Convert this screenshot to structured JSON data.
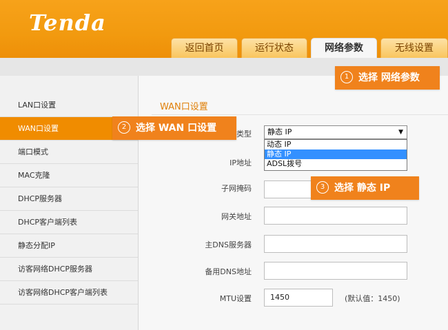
{
  "brand": {
    "logo": "Tenda"
  },
  "tabs": [
    {
      "label": "返回首页",
      "active": false
    },
    {
      "label": "运行状态",
      "active": false
    },
    {
      "label": "网络参数",
      "active": true
    },
    {
      "label": "无线设置",
      "active": false
    }
  ],
  "sidebar": {
    "items": [
      {
        "label": "LAN口设置",
        "active": false
      },
      {
        "label": "WAN口设置",
        "active": true
      },
      {
        "label": "端口模式",
        "active": false
      },
      {
        "label": "MAC克隆",
        "active": false
      },
      {
        "label": "DHCP服务器",
        "active": false
      },
      {
        "label": "DHCP客户端列表",
        "active": false
      },
      {
        "label": "静态分配IP",
        "active": false
      },
      {
        "label": "访客网络DHCP服务器",
        "active": false
      },
      {
        "label": "访客网络DHCP客户端列表",
        "active": false
      }
    ]
  },
  "main": {
    "section_title": "WAN口设置",
    "form": {
      "type_label_visible": "类型",
      "type_select": {
        "value": "静态 IP",
        "options": [
          "动态 IP",
          "静态 IP",
          "ADSL拨号"
        ],
        "highlighted": "静态 IP"
      },
      "ip_label": "IP地址",
      "subnet_label": "子网掩码",
      "gateway_label": "网关地址",
      "dns_primary_label": "主DNS服务器",
      "dns_backup_label": "备用DNS地址",
      "mtu_label": "MTU设置",
      "mtu_value": "1450",
      "mtu_default_note": "(默认值：1450)"
    }
  },
  "callouts": {
    "step1": {
      "num": "1",
      "text": "选择  网络参数"
    },
    "step2": {
      "num": "2",
      "text": "选择  WAN 口设置"
    },
    "step3": {
      "num": "3",
      "text": "选择  静态 IP"
    }
  },
  "colors": {
    "header": "#f29a0f",
    "accent": "#f08c00",
    "callout": "#f0821c",
    "selection": "#3390ff"
  }
}
